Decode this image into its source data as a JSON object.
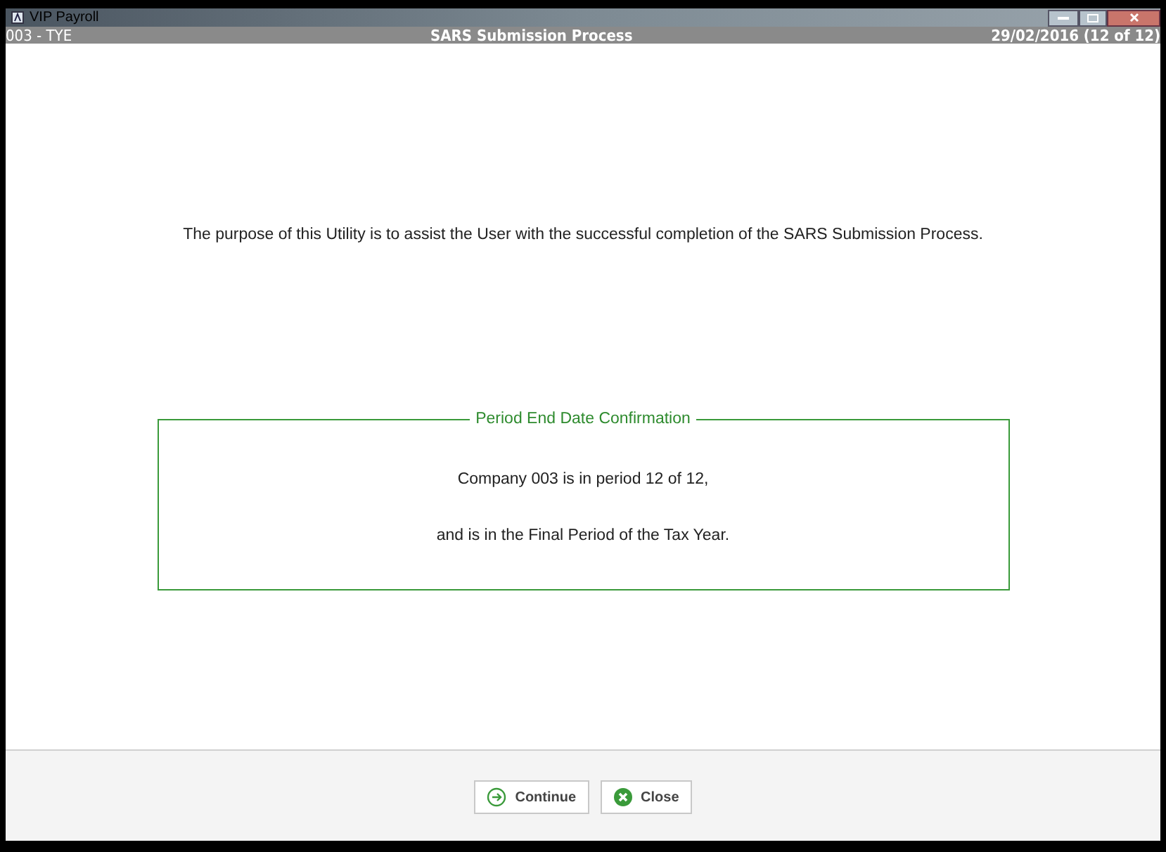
{
  "window": {
    "title": "VIP Payroll"
  },
  "header": {
    "company": "003 - TYE",
    "title": "SARS Submission Process",
    "period": "29/02/2016 (12 of 12)"
  },
  "intro": "The purpose of this Utility is to assist the User with the successful completion of the SARS Submission Process.",
  "group": {
    "title": "Period End Date Confirmation",
    "lines": [
      "Company 003 is in period 12 of 12,",
      "and is in the Final Period of the Tax Year."
    ]
  },
  "buttons": [
    {
      "kind": "continue",
      "label": "Continue"
    },
    {
      "kind": "close",
      "label": "Close"
    }
  ]
}
